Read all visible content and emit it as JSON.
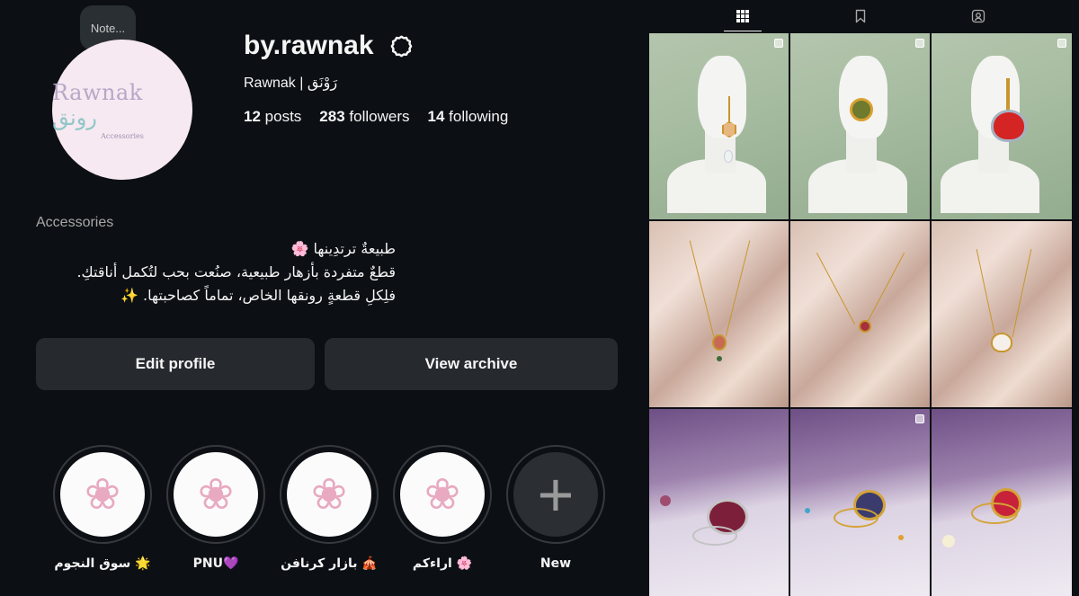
{
  "profile": {
    "username": "by.rawnak",
    "full_name": "Rawnak | رَوْنَق",
    "note": "Note...",
    "avatar_logo_latin": "Rawnak",
    "avatar_logo_arabic": "رونق",
    "avatar_logo_sub": "Accessories",
    "stats": {
      "posts_count": "12",
      "posts_label": "posts",
      "followers_count": "283",
      "followers_label": "followers",
      "following_count": "14",
      "following_label": "following"
    },
    "category": "Accessories",
    "bio_lines": [
      "طبيعةٌ ترتدِينها 🌸",
      "قطعٌ متفردة بأزهار طبيعية، صنُعت بحب لتُكمل أناقتكِ.",
      "فلِكلِ قطعةٍ رونقها الخاص، تماماً كصاحبتها. ✨"
    ]
  },
  "buttons": {
    "edit_profile": "Edit profile",
    "view_archive": "View archive"
  },
  "highlights": [
    {
      "label": "سوق النجوم 🌟",
      "icon": "rose-icon"
    },
    {
      "label": "PNU💜",
      "icon": "rose-icon"
    },
    {
      "label": "بازار كرنافن 🎪",
      "icon": "rose-icon"
    },
    {
      "label": "اراءكم 🌸",
      "icon": "rose-icon"
    },
    {
      "label": "New",
      "icon": "plus-icon"
    }
  ],
  "tabs": [
    {
      "name": "posts",
      "icon": "grid-icon",
      "active": true
    },
    {
      "name": "saved",
      "icon": "bookmark-icon",
      "active": false
    },
    {
      "name": "tagged",
      "icon": "tagged-person-icon",
      "active": false
    }
  ],
  "posts": [
    {
      "subject": "hexagon drop earring on white bust",
      "multi": true
    },
    {
      "subject": "round stud earring on white bust",
      "multi": true
    },
    {
      "subject": "heart earring with red flower on white bust",
      "multi": true
    },
    {
      "subject": "necklace with hexagon pendant on satin",
      "multi": false
    },
    {
      "subject": "necklace with small round pendant on satin",
      "multi": false
    },
    {
      "subject": "necklace with heart pendant on satin",
      "multi": false
    },
    {
      "subject": "heart ring on lilac background",
      "multi": false
    },
    {
      "subject": "heart ring with colored flowers",
      "multi": true
    },
    {
      "subject": "round ring with red flower",
      "multi": false
    }
  ],
  "colors": {
    "background": "#0c1014",
    "button": "#262a2e",
    "text": "#f5f5f5",
    "muted": "#a8a8a8"
  }
}
